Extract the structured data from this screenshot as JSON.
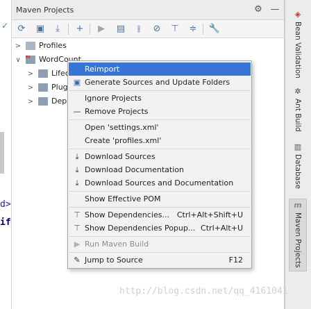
{
  "panel": {
    "title": "Maven Projects",
    "settings_icon": "gear-icon",
    "hide_icon": "minimize-icon"
  },
  "toolbar": {
    "icons": [
      "refresh-icon",
      "generate-sources-icon",
      "download-icon",
      "add-icon",
      "run-icon",
      "execute-goal-icon",
      "toggle-offline-icon",
      "skip-tests-icon",
      "show-dependencies-icon",
      "collapse-all-icon",
      "settings-wrench-icon"
    ]
  },
  "tree": {
    "profiles": "Profiles",
    "project": "WordCount",
    "lifecycle": "Lifec",
    "plugins": "Plugi",
    "dependencies": "Depe"
  },
  "left_code": {
    "line1": "d>",
    "line2": "if"
  },
  "context_menu": {
    "items": [
      {
        "label": "Reimport",
        "shortcut": "",
        "icon": "reimport-icon",
        "selected": true,
        "disabled": false
      },
      {
        "label": "Generate Sources and Update Folders",
        "shortcut": "",
        "icon": "generate-sources-icon",
        "selected": false,
        "disabled": false
      },
      {
        "label": "Ignore Projects",
        "shortcut": "",
        "icon": "",
        "selected": false,
        "disabled": false
      },
      {
        "label": "Remove Projects",
        "shortcut": "",
        "icon": "minus-icon",
        "selected": false,
        "disabled": false
      },
      {
        "label": "Open 'settings.xml'",
        "shortcut": "",
        "icon": "",
        "selected": false,
        "disabled": false
      },
      {
        "label": "Create 'profiles.xml'",
        "shortcut": "",
        "icon": "",
        "selected": false,
        "disabled": false
      },
      {
        "label": "Download Sources",
        "shortcut": "",
        "icon": "download-icon",
        "selected": false,
        "disabled": false
      },
      {
        "label": "Download Documentation",
        "shortcut": "",
        "icon": "download-icon",
        "selected": false,
        "disabled": false
      },
      {
        "label": "Download Sources and Documentation",
        "shortcut": "",
        "icon": "download-icon",
        "selected": false,
        "disabled": false
      },
      {
        "label": "Show Effective POM",
        "shortcut": "",
        "icon": "",
        "selected": false,
        "disabled": false
      },
      {
        "label": "Show Dependencies...",
        "shortcut": "Ctrl+Alt+Shift+U",
        "icon": "dependencies-icon",
        "selected": false,
        "disabled": false
      },
      {
        "label": "Show Dependencies Popup...",
        "shortcut": "Ctrl+Alt+U",
        "icon": "dependencies-icon",
        "selected": false,
        "disabled": false
      },
      {
        "label": "Run Maven Build",
        "shortcut": "",
        "icon": "run-icon",
        "selected": false,
        "disabled": true
      },
      {
        "label": "Jump to Source",
        "shortcut": "F12",
        "icon": "edit-icon",
        "selected": false,
        "disabled": false
      }
    ]
  },
  "right_tabs": [
    {
      "label": "Bean Validation",
      "icon": "bean-validation-icon",
      "active": false
    },
    {
      "label": "Ant Build",
      "icon": "ant-icon",
      "active": false
    },
    {
      "label": "Database",
      "icon": "database-icon",
      "active": false
    },
    {
      "label": "Maven Projects",
      "icon": "maven-icon",
      "active": true
    }
  ],
  "watermark": "http://blog.csdn.net/qq_4161041"
}
